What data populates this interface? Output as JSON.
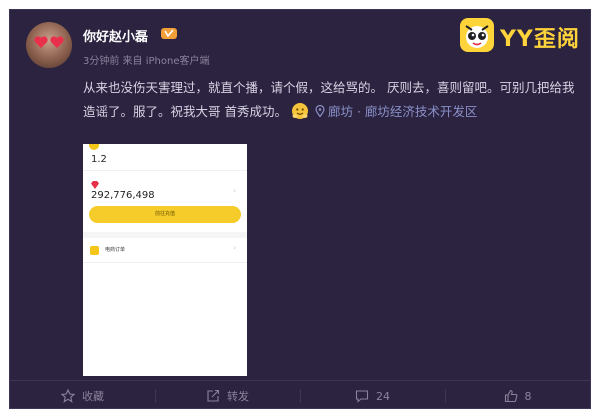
{
  "user": {
    "name": "你好赵小磊",
    "meta": "3分钟前 来自 iPhone客户端"
  },
  "brand": {
    "logo_text": "YY歪阅"
  },
  "post": {
    "text": "从来也没伤天害理过，就直个播，请个假，这给骂的。 厌则去，喜则留吧。可别几把给我造谣了。服了。祝我大哥 首秀成功。",
    "location": "廊坊 · 廊坊经济技术开发区"
  },
  "screenshot": {
    "value_top": "1.2",
    "value_main": "292,776,498",
    "button_label": "前往充值",
    "order_label": "电商订单"
  },
  "actions": {
    "favorite": "收藏",
    "repost": "转发",
    "comments": "24",
    "likes": "8"
  },
  "colors": {
    "background": "#2b2340",
    "text": "#d8d3e4",
    "muted": "#8b839c",
    "accent": "#ffd33a"
  }
}
